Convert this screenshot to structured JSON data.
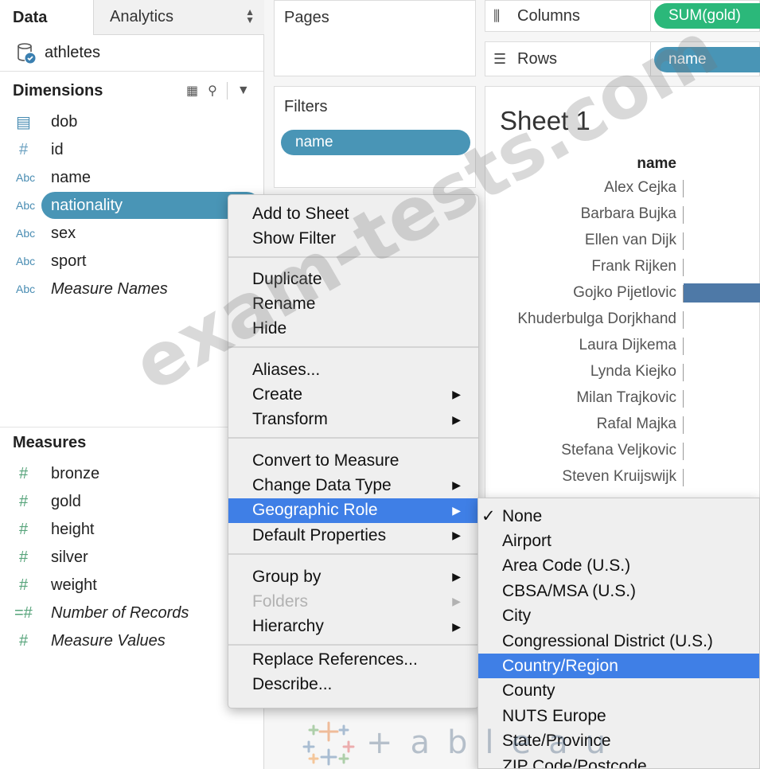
{
  "tabs": {
    "data": "Data",
    "analytics": "Analytics"
  },
  "datasource": {
    "name": "athletes"
  },
  "dimensions": {
    "header": "Dimensions",
    "fields": [
      {
        "icon": "calendar-icon",
        "type": "cal",
        "label": "dob"
      },
      {
        "icon": "number-icon",
        "type": "hash",
        "label": "id"
      },
      {
        "icon": "string-icon",
        "type": "abc",
        "label": "name"
      },
      {
        "icon": "string-icon",
        "type": "abc",
        "label": "nationality",
        "selected": true
      },
      {
        "icon": "string-icon",
        "type": "abc",
        "label": "sex"
      },
      {
        "icon": "string-icon",
        "type": "abc",
        "label": "sport"
      },
      {
        "icon": "string-icon",
        "type": "abc",
        "label": "Measure Names",
        "italic": true
      }
    ]
  },
  "measures": {
    "header": "Measures",
    "fields": [
      {
        "icon": "number-icon",
        "label": "bronze"
      },
      {
        "icon": "number-icon",
        "label": "gold"
      },
      {
        "icon": "number-icon",
        "label": "height"
      },
      {
        "icon": "number-icon",
        "label": "silver"
      },
      {
        "icon": "number-icon",
        "label": "weight"
      },
      {
        "icon": "number-icon",
        "label": "Number of Records",
        "italic": true
      },
      {
        "icon": "number-icon",
        "label": "Measure Values",
        "italic": true
      }
    ]
  },
  "pages": {
    "title": "Pages"
  },
  "filters": {
    "title": "Filters",
    "pill": "name"
  },
  "columns": {
    "label": "Columns",
    "pill": "SUM(gold)"
  },
  "rows": {
    "label": "Rows",
    "pill": "name"
  },
  "sheet": {
    "title": "Sheet 1",
    "header": "name",
    "rows": [
      {
        "label": "Alex Cejka",
        "bar": 0
      },
      {
        "label": "Barbara Bujka",
        "bar": 0
      },
      {
        "label": "Ellen van Dijk",
        "bar": 0
      },
      {
        "label": "Frank Rijken",
        "bar": 0
      },
      {
        "label": "Gojko Pijetlovic",
        "bar": 1
      },
      {
        "label": "Khuderbulga Dorjkhand",
        "bar": 0
      },
      {
        "label": "Laura Dijkema",
        "bar": 0
      },
      {
        "label": "Lynda Kiejko",
        "bar": 0
      },
      {
        "label": "Milan Trajkovic",
        "bar": 0
      },
      {
        "label": "Rafal Majka",
        "bar": 0
      },
      {
        "label": "Stefana Veljkovic",
        "bar": 0
      },
      {
        "label": "Steven Kruijswijk",
        "bar": 0
      }
    ]
  },
  "context_menu": {
    "groups": [
      [
        {
          "label": "Add to Sheet"
        },
        {
          "label": "Show Filter"
        }
      ],
      [
        {
          "label": "Duplicate"
        },
        {
          "label": "Rename"
        },
        {
          "label": "Hide"
        }
      ],
      [
        {
          "label": "Aliases..."
        },
        {
          "label": "Create",
          "submenu": true
        },
        {
          "label": "Transform",
          "submenu": true
        }
      ],
      [
        {
          "label": "Convert to Measure"
        },
        {
          "label": "Change Data Type",
          "submenu": true
        },
        {
          "label": "Geographic Role",
          "submenu": true,
          "highlighted": true
        },
        {
          "label": "Default Properties",
          "submenu": true
        }
      ],
      [
        {
          "label": "Group by",
          "submenu": true
        },
        {
          "label": "Folders",
          "submenu": true,
          "disabled": true
        },
        {
          "label": "Hierarchy",
          "submenu": true
        }
      ],
      [
        {
          "label": "Replace References..."
        },
        {
          "label": "Describe..."
        }
      ]
    ]
  },
  "geographic_submenu": [
    {
      "label": "None",
      "checked": true
    },
    {
      "label": "Airport"
    },
    {
      "label": "Area Code (U.S.)"
    },
    {
      "label": "CBSA/MSA (U.S.)"
    },
    {
      "label": "City"
    },
    {
      "label": "Congressional District (U.S.)"
    },
    {
      "label": "Country/Region",
      "highlighted": true
    },
    {
      "label": "County"
    },
    {
      "label": "NUTS Europe"
    },
    {
      "label": "State/Province"
    },
    {
      "label": "ZIP Code/Postcode"
    }
  ],
  "watermark": "exam-tests.com",
  "logo": {
    "word": "+ableau"
  },
  "colors": {
    "dimension_pill": "#4995b6",
    "measure_pill": "#2bb87a",
    "menu_highlight": "#3f7fe6",
    "bar": "#4e79a7"
  }
}
